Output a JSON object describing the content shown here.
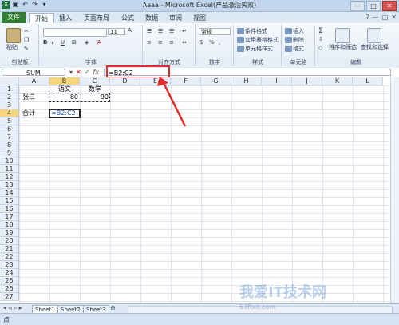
{
  "titlebar": {
    "title": "Aaaa - Microsoft Excel(产品激活失败)",
    "buttons": [
      "—",
      "□",
      "✕"
    ]
  },
  "tabs": [
    "文件",
    "开始",
    "插入",
    "页面布局",
    "公式",
    "数据",
    "审阅",
    "视图"
  ],
  "ribbon": {
    "groups": [
      "剪贴板",
      "字体",
      "对齐方式",
      "数字",
      "样式",
      "单元格",
      "编辑"
    ],
    "paste": "粘贴",
    "font_size": "11",
    "number_format": "常规",
    "styles": [
      "条件格式",
      "套用表格格式",
      "单元格样式"
    ],
    "cells": [
      "插入",
      "删除",
      "格式"
    ],
    "editing": [
      "排序和筛选",
      "查找和选择"
    ]
  },
  "formula_bar": {
    "name_box": "SUM",
    "fx": "fx",
    "formula": "=B2:C2"
  },
  "columns": [
    "A",
    "B",
    "C",
    "D",
    "E",
    "F",
    "G",
    "H",
    "I",
    "J",
    "K",
    "L"
  ],
  "rows": [
    "1",
    "2",
    "3",
    "4",
    "5",
    "6",
    "7",
    "8",
    "9",
    "10",
    "11",
    "12",
    "13",
    "14",
    "15",
    "16",
    "17",
    "18",
    "19",
    "20",
    "21",
    "22",
    "23",
    "24",
    "25",
    "26",
    "27"
  ],
  "cells": {
    "B1": "语文",
    "C1": "数学",
    "A2": "张三",
    "B2": "80",
    "C2": "90",
    "A4": "合计",
    "B4": "=B2:C2"
  },
  "sheets": [
    "Sheet1",
    "Sheet2",
    "Sheet3"
  ],
  "status": "点",
  "watermark": {
    "main": "我爱IT技术网",
    "sub": "52fixit.com"
  },
  "colors": {
    "accent_red": "#e12b2b",
    "file_tab": "#2e7d32",
    "selection": "#f7d67c"
  }
}
